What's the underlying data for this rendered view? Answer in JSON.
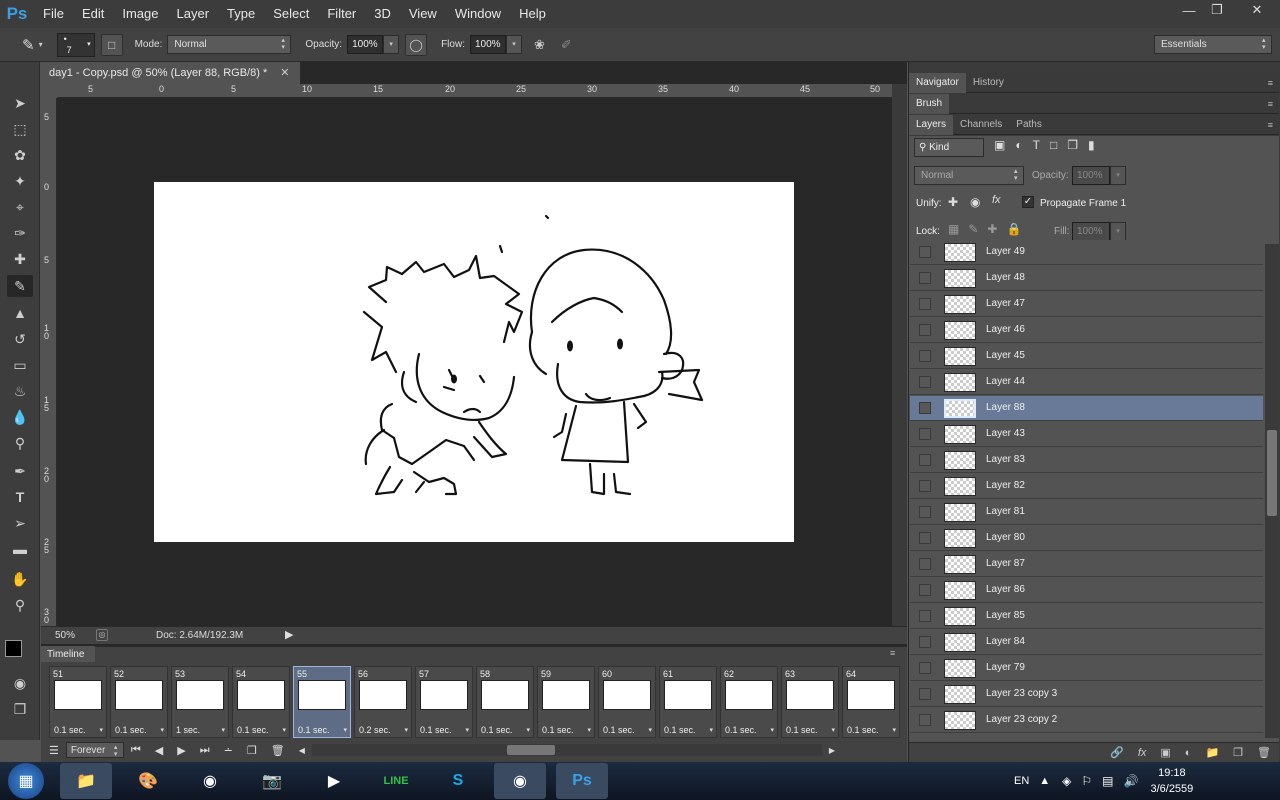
{
  "menubar": {
    "logo": "Ps",
    "items": [
      "File",
      "Edit",
      "Image",
      "Layer",
      "Type",
      "Select",
      "Filter",
      "3D",
      "View",
      "Window",
      "Help"
    ]
  },
  "options": {
    "brush_size": "7",
    "mode_label": "Mode:",
    "mode_value": "Normal",
    "opacity_label": "Opacity:",
    "opacity_value": "100%",
    "flow_label": "Flow:",
    "flow_value": "100%",
    "workspace": "Essentials"
  },
  "document": {
    "tab_title": "day1 - Copy.psd @ 50% (Layer 88, RGB/8) *",
    "zoom": "50%",
    "doc_info": "Doc: 2.64M/192.3M",
    "ruler_top": [
      "5",
      "0",
      "5",
      "10",
      "15",
      "20",
      "25",
      "30",
      "35",
      "40",
      "45",
      "50"
    ],
    "ruler_left": [
      "5",
      "0",
      "5",
      "1 0",
      "1 5",
      "2 0",
      "2 5",
      "3 0"
    ]
  },
  "panels": {
    "row1": [
      "Navigator",
      "History"
    ],
    "row2": [
      "Brush"
    ],
    "row3": [
      "Layers",
      "Channels",
      "Paths"
    ],
    "filter_kind": "Kind",
    "blend_mode": "Normal",
    "opacity_label": "Opacity:",
    "opacity_value": "100%",
    "unify_label": "Unify:",
    "propagate_label": "Propagate Frame 1",
    "lock_label": "Lock:",
    "fill_label": "Fill:",
    "fill_value": "100%"
  },
  "layers": [
    {
      "name": "Layer 49",
      "selected": false
    },
    {
      "name": "Layer 48",
      "selected": false
    },
    {
      "name": "Layer 47",
      "selected": false
    },
    {
      "name": "Layer 46",
      "selected": false
    },
    {
      "name": "Layer 45",
      "selected": false
    },
    {
      "name": "Layer 44",
      "selected": false
    },
    {
      "name": "Layer 88",
      "selected": true
    },
    {
      "name": "Layer 43",
      "selected": false
    },
    {
      "name": "Layer 83",
      "selected": false
    },
    {
      "name": "Layer 82",
      "selected": false
    },
    {
      "name": "Layer 81",
      "selected": false
    },
    {
      "name": "Layer 80",
      "selected": false
    },
    {
      "name": "Layer 87",
      "selected": false
    },
    {
      "name": "Layer 86",
      "selected": false
    },
    {
      "name": "Layer 85",
      "selected": false
    },
    {
      "name": "Layer 84",
      "selected": false
    },
    {
      "name": "Layer 79",
      "selected": false
    },
    {
      "name": "Layer 23 copy 3",
      "selected": false
    },
    {
      "name": "Layer 23 copy 2",
      "selected": false
    }
  ],
  "timeline": {
    "title": "Timeline",
    "loop": "Forever",
    "frames": [
      {
        "num": "51",
        "delay": "0.1 sec."
      },
      {
        "num": "52",
        "delay": "0.1 sec."
      },
      {
        "num": "53",
        "delay": "1 sec."
      },
      {
        "num": "54",
        "delay": "0.1 sec."
      },
      {
        "num": "55",
        "delay": "0.1 sec.",
        "selected": true
      },
      {
        "num": "56",
        "delay": "0.2 sec."
      },
      {
        "num": "57",
        "delay": "0.1 sec."
      },
      {
        "num": "58",
        "delay": "0.1 sec."
      },
      {
        "num": "59",
        "delay": "0.1 sec."
      },
      {
        "num": "60",
        "delay": "0.1 sec."
      },
      {
        "num": "61",
        "delay": "0.1 sec."
      },
      {
        "num": "62",
        "delay": "0.1 sec."
      },
      {
        "num": "63",
        "delay": "0.1 sec."
      },
      {
        "num": "64",
        "delay": "0.1 sec."
      }
    ]
  },
  "taskbar": {
    "lang": "EN",
    "time": "19:18",
    "date": "3/6/2559",
    "apps": [
      "start-orb",
      "file-explorer",
      "paint",
      "chrome",
      "photo-viewer",
      "media-player",
      "line",
      "skype",
      "chrome-2",
      "photoshop"
    ]
  }
}
